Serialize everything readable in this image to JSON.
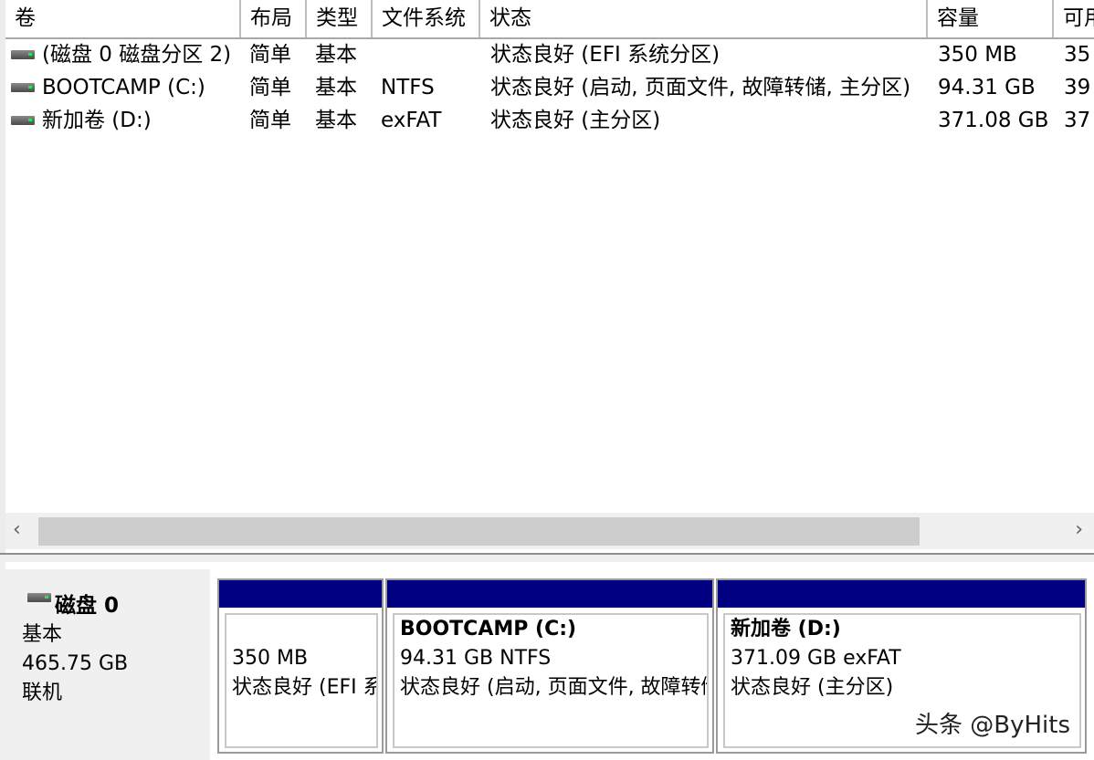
{
  "columns": [
    "卷",
    "布局",
    "类型",
    "文件系统",
    "状态",
    "容量",
    "可用"
  ],
  "volumes": [
    {
      "name": "(磁盘 0 磁盘分区 2)",
      "layout": "简单",
      "type": "基本",
      "fs": "",
      "status": "状态良好 (EFI 系统分区)",
      "capacity": "350 MB",
      "free": "35"
    },
    {
      "name": "BOOTCAMP (C:)",
      "layout": "简单",
      "type": "基本",
      "fs": "NTFS",
      "status": "状态良好 (启动, 页面文件, 故障转储, 主分区)",
      "capacity": "94.31 GB",
      "free": "39"
    },
    {
      "name": "新加卷 (D:)",
      "layout": "简单",
      "type": "基本",
      "fs": "exFAT",
      "status": "状态良好 (主分区)",
      "capacity": "371.08 GB",
      "free": "37"
    }
  ],
  "scroll": {
    "left": "‹",
    "right": "›"
  },
  "disk": {
    "name": "磁盘 0",
    "type": "基本",
    "size": "465.75 GB",
    "status": "联机"
  },
  "partitions": [
    {
      "title": "",
      "size_fs": "350 MB",
      "status": "状态良好 (EFI 系统分区)"
    },
    {
      "title": "BOOTCAMP  (C:)",
      "size_fs": "94.31 GB NTFS",
      "status": "状态良好 (启动, 页面文件, 故障转储, 主分区)"
    },
    {
      "title": "新加卷  (D:)",
      "size_fs": "371.09 GB exFAT",
      "status": "状态良好 (主分区)"
    }
  ],
  "watermark": "头条 @ByHits",
  "colors": {
    "partition_bar": "#000080",
    "scroll_thumb": "#cdcdcd"
  }
}
